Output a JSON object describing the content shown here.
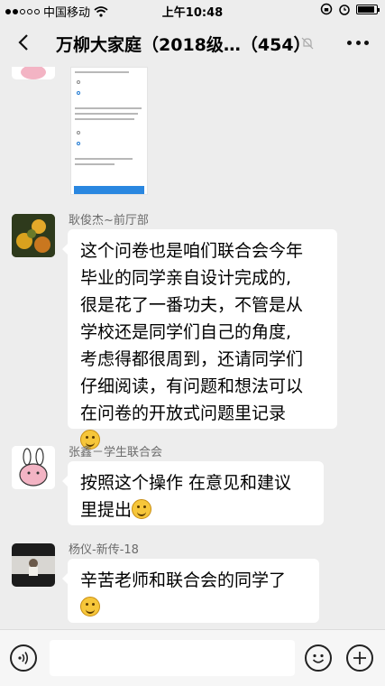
{
  "status_bar": {
    "carrier": "中国移动",
    "time": "上午10:48",
    "battery_level": 0.9
  },
  "title_bar": {
    "title": "万柳大家庭（2018级…（454）"
  },
  "messages": [
    {
      "sender": "耿俊杰~前厅部",
      "lines": [
        "这个问卷也是咱们联合会今年",
        "毕业的同学亲自设计完成的,",
        "很是花了一番功夫，不管是从",
        "学校还是同学们自己的角度,",
        "考虑得都很周到，还请同学们",
        "仔细阅读，有问题和想法可以",
        "在问卷的开放式问题里记录"
      ],
      "emoji": "grin-emoji"
    },
    {
      "sender": "张鑫－学生联合会",
      "lines": [
        "按照这个操作 在意见和建议",
        "里提出"
      ],
      "emoji": "thinking-emoji"
    },
    {
      "sender": "杨仪-新传-18",
      "lines": [
        "辛苦老师和联合会的同学了"
      ],
      "emoji": "clap-emoji"
    }
  ],
  "icons": {
    "back": "chevron-left-icon",
    "mute": "bell-muted-icon",
    "more": "more-dots-icon",
    "voice": "voice-icon",
    "emoji": "emoji-icon",
    "plus": "plus-icon"
  },
  "colors": {
    "background": "#ededed",
    "bubble": "#ffffff",
    "sender_name": "#6b6b6b"
  }
}
